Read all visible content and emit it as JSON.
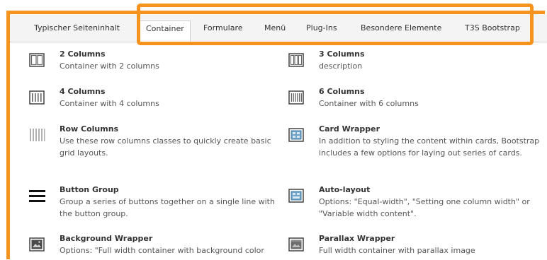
{
  "tabs": [
    {
      "label": "Typischer Seiteninhalt",
      "active": false
    },
    {
      "label": "Container",
      "active": true
    },
    {
      "label": "Formulare",
      "active": false
    },
    {
      "label": "Menü",
      "active": false
    },
    {
      "label": "Plug-Ins",
      "active": false
    },
    {
      "label": "Besondere Elemente",
      "active": false
    },
    {
      "label": "T3S Bootstrap",
      "active": false
    }
  ],
  "items": [
    {
      "title": "2 Columns",
      "desc": "Container with 2 columns",
      "icon": "two-columns-icon"
    },
    {
      "title": "3 Columns",
      "desc": "description",
      "icon": "three-columns-icon"
    },
    {
      "title": "4 Columns",
      "desc": "Container with 4 columns",
      "icon": "four-columns-icon"
    },
    {
      "title": "6 Columns",
      "desc": "Container with 6 columns",
      "icon": "six-columns-icon"
    },
    {
      "title": "Row Columns",
      "desc": "Use these row columns classes to quickly create basic grid layouts.",
      "icon": "row-columns-icon"
    },
    {
      "title": "Card Wrapper",
      "desc": "In addition to styling the content within cards, Bootstrap includes a few options for laying out series of cards.",
      "icon": "card-wrapper-icon"
    },
    {
      "title": "Button Group",
      "desc": "Group a series of buttons together on a single line with the button group.",
      "icon": "button-group-icon"
    },
    {
      "title": "Auto-layout",
      "desc": "Options: \"Equal-width\", \"Setting one column width\" or \"Variable width content\".",
      "icon": "auto-layout-icon"
    },
    {
      "title": "Background Wrapper",
      "desc": "Options: \"Full width container with background color",
      "icon": "background-wrapper-icon"
    },
    {
      "title": "Parallax Wrapper",
      "desc": "Full width container with parallax image",
      "icon": "parallax-wrapper-icon"
    }
  ],
  "colors": {
    "highlight": "#f6931f",
    "tab_bg": "#f4f4f4"
  }
}
